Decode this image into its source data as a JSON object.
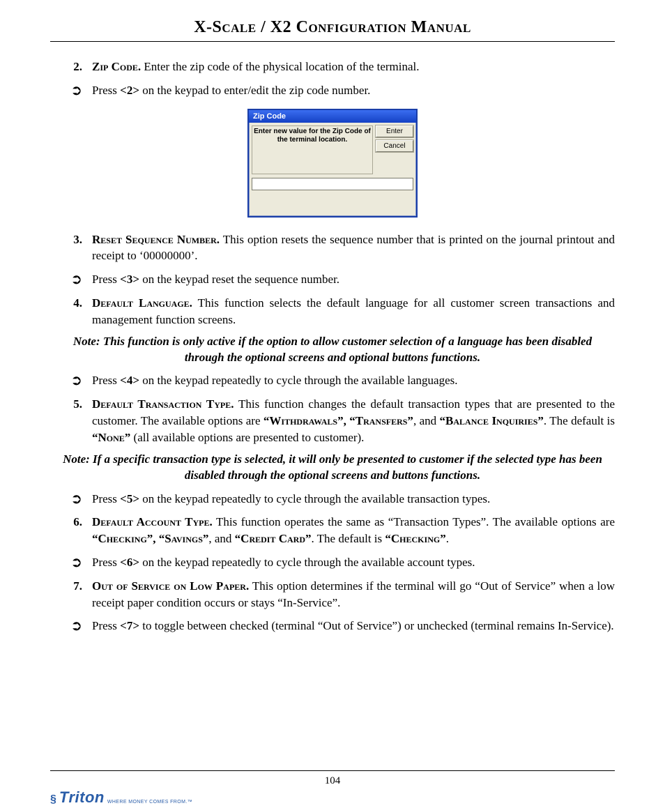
{
  "doc_title": "X-Scale / X2 Configuration Manual",
  "page_number": "104",
  "brand": {
    "name": "Triton",
    "tagline": "WHERE MONEY COMES FROM.™"
  },
  "dialog": {
    "title": "Zip Code",
    "message": "Enter new value for the Zip Code of the terminal location.",
    "enter": "Enter",
    "cancel": "Cancel"
  },
  "items": {
    "i2": {
      "num": "2.",
      "heading": "Zip Code.",
      "body": "  Enter the zip code of the physical location of the terminal.",
      "arrow": "Press <2> on the keypad to enter/edit the zip code number.",
      "key": "<2>"
    },
    "i3": {
      "num": "3.",
      "heading": "Reset Sequence Number.",
      "body": "   This option resets the sequence number that is printed on the journal printout and receipt to ‘00000000’.",
      "arrow": "Press <3> on the keypad reset the sequence number.",
      "key": "<3>"
    },
    "i4": {
      "num": "4.",
      "heading": "Default Language.",
      "body": "  This function selects the default language for all customer screen transactions and management function screens.",
      "note": "Note:  This function is only active if the option to allow customer  selection of a language has been disabled through the optional screens and optional buttons functions.",
      "arrow": "Press <4> on the keypad repeatedly to cycle through the available languages.",
      "key": "<4>"
    },
    "i5": {
      "num": "5.",
      "heading": "Default Transaction Type.",
      "body_pre": "  This function changes the default transaction types that are presented to the customer.  The available options are ",
      "opt1": "“Withdrawals”, “Transfers”",
      "mid1": ", and ",
      "opt2": "“Balance Inquiries”",
      "mid2": ".  The default is ",
      "opt3": "“None”",
      "tail": " (all available options are presented to customer).",
      "note": "Note:  If a specific transaction type is selected, it will only be presented to customer if the selected type has been disabled through the optional screens and buttons functions.",
      "arrow": "Press <5> on the keypad repeatedly to cycle through the available transaction types.",
      "key": "<5>"
    },
    "i6": {
      "num": "6.",
      "heading": "Default Account Type.",
      "body_pre": "   This function operates the same as “Transaction Types”.  The available options are ",
      "opt1": "“Checking”, “Savings”",
      "mid1": ", and ",
      "opt2": "“Credit Card”",
      "mid2": ".  The default is ",
      "opt3": "“Checking”",
      "tail": ".",
      "arrow": "Press <6> on the keypad repeatedly to cycle through the available account types.",
      "key": "<6>"
    },
    "i7": {
      "num": "7.",
      "heading": "Out of Service on Low Paper.",
      "body": " This option determines if the terminal will go “Out of Service” when a low receipt paper condition occurs or stays “In-Service”.",
      "arrow": "Press <7> to toggle between checked (terminal “Out of  Service”) or unchecked (terminal remains In-Service).",
      "key": "<7>"
    }
  }
}
